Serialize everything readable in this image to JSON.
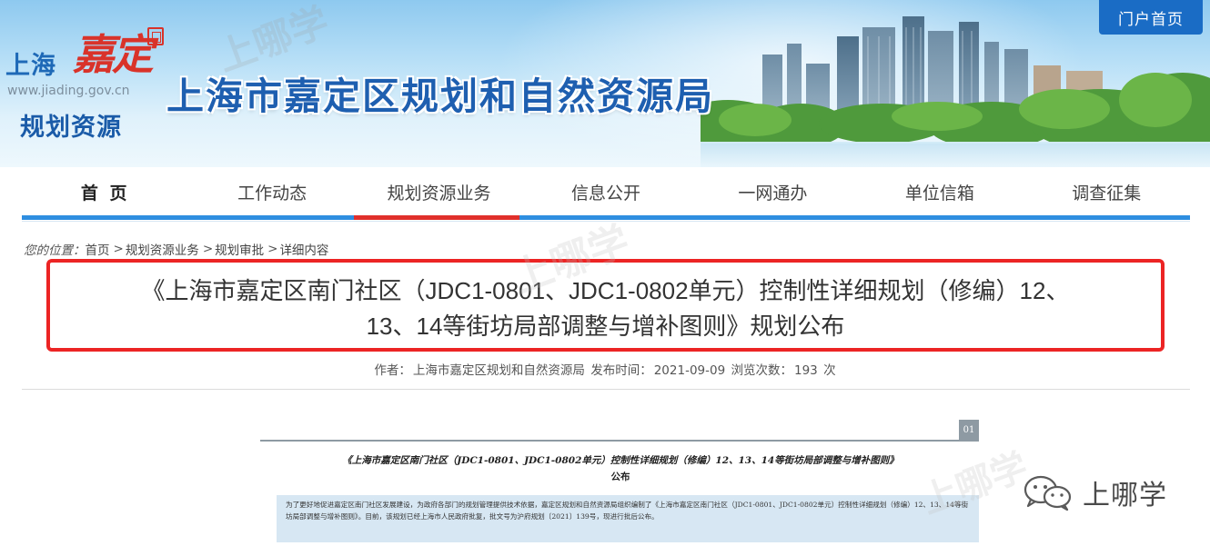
{
  "header": {
    "logo_shanghai": "上海",
    "logo_jiading": "嘉定",
    "logo_url": "www.jiading.gov.cn",
    "logo_subtitle": "规划资源",
    "site_title": "上海市嘉定区规划和自然资源局",
    "portal_button": "门户首页"
  },
  "nav": {
    "items": [
      {
        "label": "首 页"
      },
      {
        "label": "工作动态"
      },
      {
        "label": "规划资源业务"
      },
      {
        "label": "信息公开"
      },
      {
        "label": "一网通办"
      },
      {
        "label": "单位信箱"
      },
      {
        "label": "调查征集"
      }
    ],
    "active_index": 2
  },
  "breadcrumb": {
    "prefix": "您的位置：",
    "items": [
      "首页",
      "规划资源业务",
      "规划审批",
      "详细内容"
    ],
    "separator": ">"
  },
  "article": {
    "title_line1": "《上海市嘉定区南门社区（JDC1-0801、JDC1-0802单元）控制性详细规划（修编）12、",
    "title_line2": "13、14等街坊局部调整与增补图则》规划公布",
    "meta_author_label": "作者：",
    "meta_author": "上海市嘉定区规划和自然资源局",
    "meta_date_label": "发布时间：",
    "meta_date": "2021-09-09",
    "meta_views_label": "浏览次数：",
    "meta_views": "193",
    "meta_views_unit": "次"
  },
  "document": {
    "badge": "01",
    "title": "《上海市嘉定区南门社区（JDC1-0801、JDC1-0802单元）控制性详细规划（修编）12、13、14等街坊局部调整与增补图则》",
    "title_suffix": "公布",
    "paragraph": "为了更好地促进嘉定区南门社区发展建设，为政府各部门的规划管理提供技术依据，嘉定区规划和自然资源局组织编制了《上海市嘉定区南门社区（JDC1-0801、JDC1-0802单元）控制性详细规划（修编）12、13、14等街坊局部调整与增补图则》。目前，该规划已经上海市人民政府批复，批文号为沪府规划〔2021〕139号，现进行批后公布。"
  },
  "watermark": {
    "text": "上哪学",
    "wechat_label": "上哪学"
  },
  "colors": {
    "nav_bar": "#2e8ee0",
    "nav_active": "#e0302b",
    "highlight_box": "#ec2424",
    "portal_button": "#1a6cc5",
    "site_title": "#1e5fb0"
  }
}
